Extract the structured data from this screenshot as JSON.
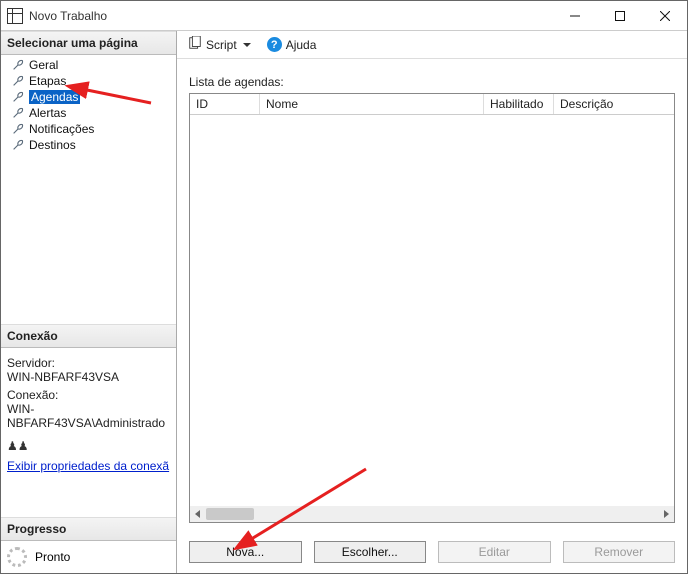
{
  "window": {
    "title": "Novo Trabalho"
  },
  "sidebar": {
    "select_page_label": "Selecionar uma página",
    "items": [
      {
        "label": "Geral"
      },
      {
        "label": "Etapas"
      },
      {
        "label": "Agendas"
      },
      {
        "label": "Alertas"
      },
      {
        "label": "Notificações"
      },
      {
        "label": "Destinos"
      }
    ],
    "selected_index": 2,
    "connection_label": "Conexão",
    "server_caption": "Servidor:",
    "server_value": "WIN-NBFARF43VSA",
    "conn_caption": "Conexão:",
    "conn_value": "WIN-NBFARF43VSA\\Administrado",
    "conn_link": "Exibir propriedades da conexã",
    "progress_label": "Progresso",
    "progress_status": "Pronto"
  },
  "toolbar": {
    "script_label": "Script",
    "help_label": "Ajuda"
  },
  "list": {
    "caption": "Lista de agendas:",
    "columns": {
      "id": "ID",
      "nome": "Nome",
      "hab": "Habilitado",
      "desc": "Descrição"
    }
  },
  "buttons": {
    "nova": "Nova...",
    "escolher": "Escolher...",
    "editar": "Editar",
    "remover": "Remover"
  }
}
